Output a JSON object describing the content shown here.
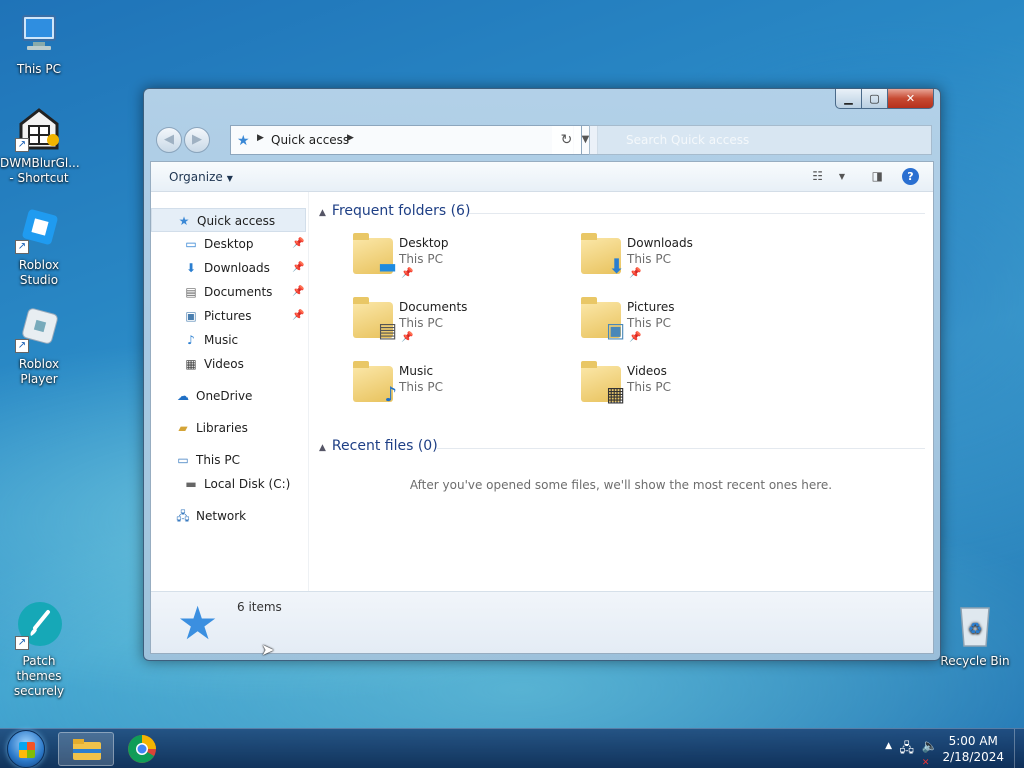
{
  "desktop": {
    "icons": [
      {
        "label": "This PC"
      },
      {
        "label": "DWMBlurGl...\n- Shortcut"
      },
      {
        "label": "Roblox Studio"
      },
      {
        "label": "Roblox Player"
      },
      {
        "label": "Patch themes\nsecurely"
      },
      {
        "label": "Recycle Bin"
      }
    ]
  },
  "window": {
    "address": {
      "crumb": "Quick access"
    },
    "search": {
      "placeholder": "Search Quick access"
    },
    "toolbar": {
      "organize": "Organize"
    },
    "nav": {
      "items": [
        {
          "label": "Quick access",
          "icon": "star-icon"
        },
        {
          "label": "Desktop",
          "icon": "desktop-icon",
          "pinned": true
        },
        {
          "label": "Downloads",
          "icon": "download-icon",
          "pinned": true
        },
        {
          "label": "Documents",
          "icon": "document-icon",
          "pinned": true
        },
        {
          "label": "Pictures",
          "icon": "picture-icon",
          "pinned": true
        },
        {
          "label": "Music",
          "icon": "music-icon"
        },
        {
          "label": "Videos",
          "icon": "video-icon"
        },
        {
          "label": "OneDrive",
          "icon": "cloud-icon"
        },
        {
          "label": "Libraries",
          "icon": "library-icon"
        },
        {
          "label": "This PC",
          "icon": "computer-icon"
        },
        {
          "label": "Local Disk (C:)",
          "icon": "drive-icon"
        },
        {
          "label": "Network",
          "icon": "network-icon"
        }
      ]
    },
    "frequent": {
      "header": "Frequent folders (6)",
      "folders": [
        {
          "name": "Desktop",
          "location": "This PC",
          "pinned": true
        },
        {
          "name": "Downloads",
          "location": "This PC",
          "pinned": true
        },
        {
          "name": "Documents",
          "location": "This PC",
          "pinned": true
        },
        {
          "name": "Pictures",
          "location": "This PC",
          "pinned": true
        },
        {
          "name": "Music",
          "location": "This PC",
          "pinned": false
        },
        {
          "name": "Videos",
          "location": "This PC",
          "pinned": false
        }
      ]
    },
    "recent": {
      "header": "Recent files (0)",
      "empty_message": "After you've opened some files, we'll show the most recent ones here."
    },
    "details": {
      "count": "6 items"
    }
  },
  "taskbar": {
    "clock": {
      "time": "5:00 AM",
      "date": "2/18/2024"
    }
  },
  "colors": {
    "accent": "#3b8fe0",
    "header_text": "#1e3f85",
    "close_red": "#c74a32"
  }
}
